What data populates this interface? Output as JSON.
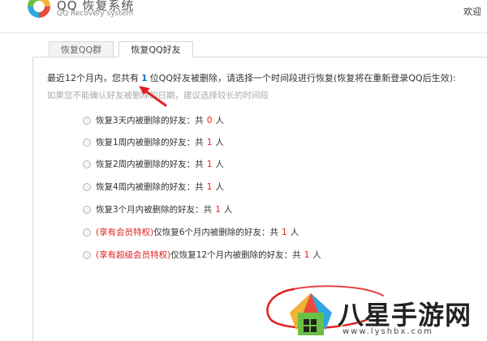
{
  "header": {
    "app_title": "QQ 恢复系统",
    "app_subtitle": "QQ Recovery system",
    "welcome": "欢迎"
  },
  "tabs": [
    {
      "label": "恢复QQ群",
      "active": false
    },
    {
      "label": "恢复QQ好友",
      "active": true
    }
  ],
  "intro": {
    "prefix": "最近12个月内，您共有",
    "count": "1",
    "suffix": "位QQ好友被删除，请选择一个时间段进行恢复(恢复将在重新登录QQ后生效):",
    "hint": "如果您不能确认好友被删除的日期，建议选择较长的时间段"
  },
  "options": [
    {
      "label": "恢复3天内被删除的好友：共",
      "count": "0",
      "unit": "人"
    },
    {
      "label": "恢复1周内被删除的好友：共",
      "count": "1",
      "unit": "人"
    },
    {
      "label": "恢复2周内被删除的好友：共",
      "count": "1",
      "unit": "人"
    },
    {
      "label": "恢复4周内被删除的好友：共",
      "count": "1",
      "unit": "人"
    },
    {
      "label": "恢复3个月内被删除的好友：共",
      "count": "1",
      "unit": "人"
    },
    {
      "privilege": "(享有会员特权)",
      "label": "仅恢复6个月内被删除的好友：共",
      "count": "1",
      "unit": "人"
    },
    {
      "privilege": "(享有超级会员特权)",
      "label": "仅恢复12个月内被删除的好友：共",
      "count": "1",
      "unit": "人"
    }
  ],
  "watermark": {
    "text": "八星手游网",
    "url": "www.lyshbx.com"
  },
  "colors": {
    "accent_blue": "#1a6fd1",
    "highlight_red": "#e02020",
    "hint_gray": "#aaaaaa"
  }
}
